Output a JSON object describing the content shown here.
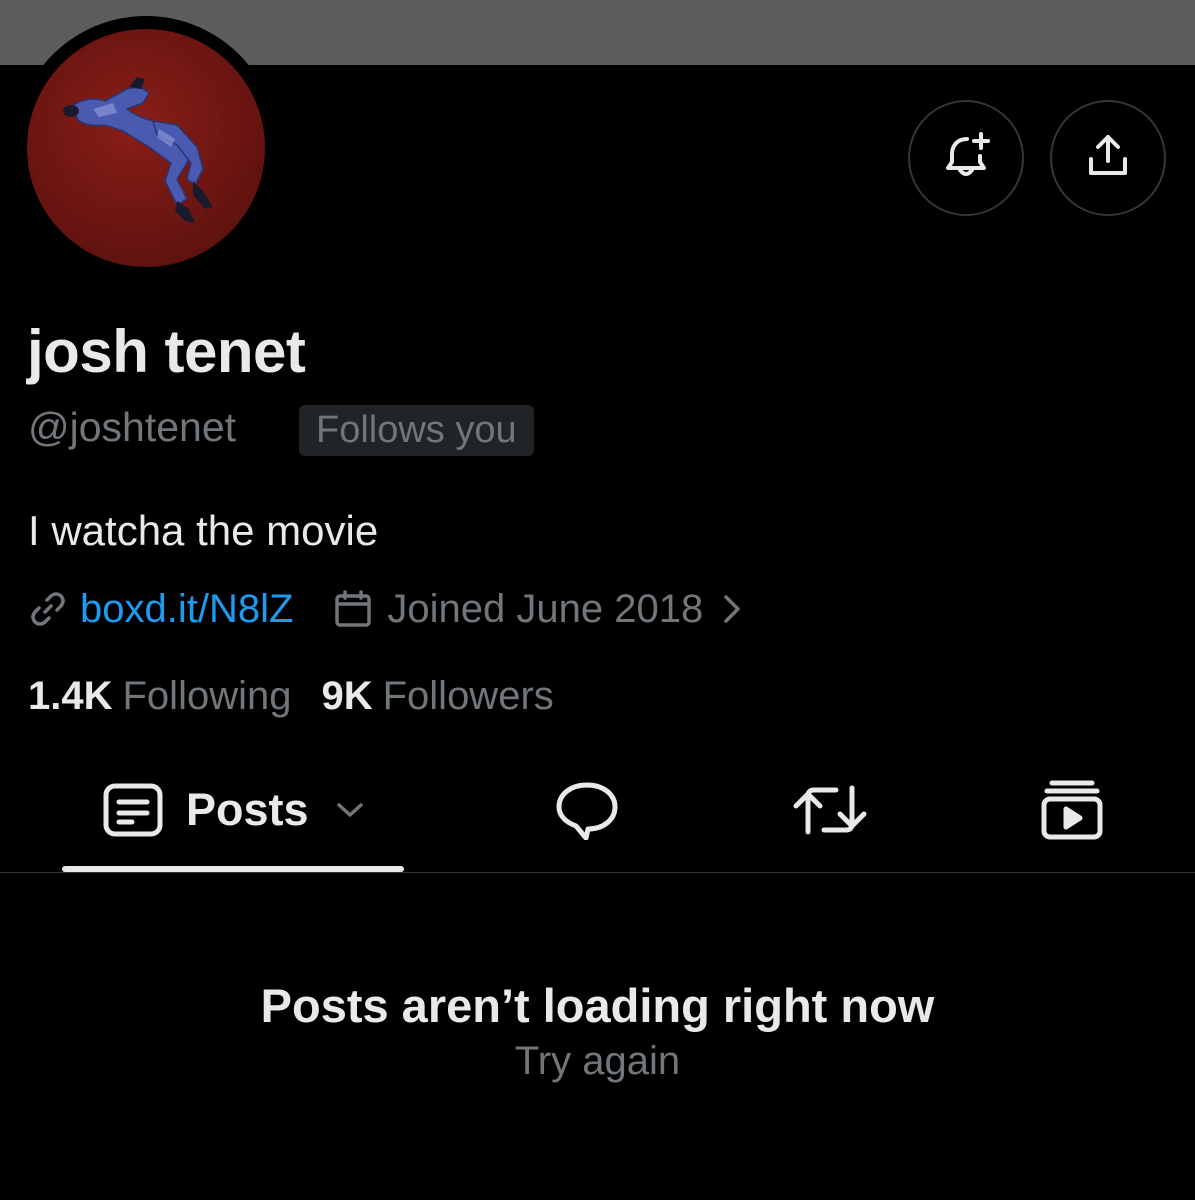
{
  "profile": {
    "display_name": "josh tenet",
    "handle": "@joshtenet",
    "follows_you_badge": "Follows you",
    "bio": "I watcha the movie",
    "website": "boxd.it/N8lZ",
    "joined": "Joined June 2018"
  },
  "stats": {
    "following_count": "1.4K",
    "following_label": "Following",
    "followers_count": "9K",
    "followers_label": "Followers"
  },
  "tabs": {
    "posts_label": "Posts"
  },
  "feed": {
    "error_title": "Posts aren’t loading right now",
    "retry_label": "Try again"
  },
  "icons": {
    "notify": "bell-plus-icon",
    "share": "share-upload-icon",
    "link": "link-icon",
    "calendar": "calendar-icon",
    "chevron": "chevron-right-icon",
    "posts": "posts-icon",
    "dropdown": "chevron-down-icon",
    "replies": "reply-bubble-icon",
    "reposts": "repost-icon",
    "media": "media-play-icon"
  },
  "colors": {
    "background": "#000000",
    "banner": "#5c5c5c",
    "primary_text": "#e7e9ea",
    "secondary_text": "#71767b",
    "link": "#1d9bf0",
    "avatar_background": "#6b1511"
  }
}
